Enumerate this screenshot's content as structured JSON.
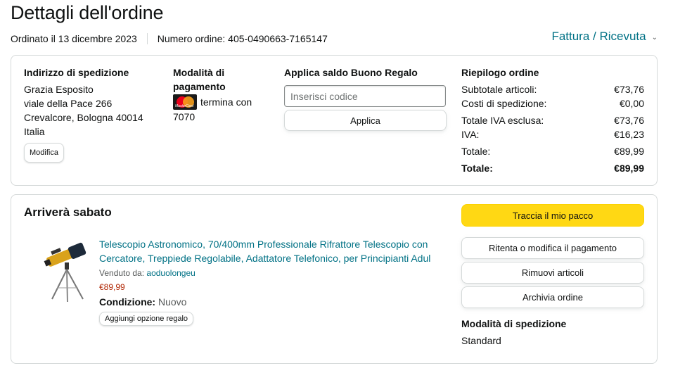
{
  "header": {
    "title": "Dettagli dell'ordine",
    "ordered_on": "Ordinato il 13 dicembre 2023",
    "order_number": "Numero ordine: 405-0490663-7165147",
    "invoice_link": "Fattura / Ricevuta",
    "invoice_chevron": "⌄"
  },
  "shipping_address": {
    "title": "Indirizzo di spedizione",
    "lines": [
      "Grazia Esposito",
      "viale della Pace 266",
      "Crevalcore, Bologna 40014",
      "Italia"
    ],
    "edit_label": "Modifica"
  },
  "payment": {
    "title": "Modalità di pagamento",
    "card_icon": "mastercard-icon",
    "card_brand_text": "MasterCard",
    "card_text": "termina con",
    "card_last4": "7070"
  },
  "gift_balance": {
    "title": "Applica saldo Buono Regalo",
    "input_placeholder": "Inserisci codice",
    "input_value": "",
    "apply_label": "Applica"
  },
  "order_summary": {
    "title": "Riepilogo ordine",
    "rows": [
      {
        "label": "Subtotale articoli:",
        "value": "€73,76"
      },
      {
        "label": "Costi di spedizione:",
        "value": "€0,00"
      },
      {
        "label": "Totale IVA esclusa:",
        "value": "€73,76"
      },
      {
        "label": "IVA:",
        "value": "€16,23"
      },
      {
        "label": "Totale:",
        "value": "€89,99"
      },
      {
        "label": "Totale:",
        "value": "€89,99"
      }
    ]
  },
  "shipment": {
    "arrival_text": "Arriverà sabato",
    "product": {
      "image_icon": "telescope-image",
      "title_line1": "Telescopio Astronomico, 70/400mm Professionale Rifrattore Telescopio con",
      "title_line2": "Cercatore, Treppiede Regolabile, Adattatore Telefonico, per Principianti Adul",
      "sold_by_label": "Venduto da:",
      "seller": "aoduolongeu",
      "price": "€89,99",
      "condition_label": "Condizione:",
      "condition_value": "Nuovo",
      "gift_option_label": "Aggiungi opzione regalo"
    },
    "actions": {
      "track": "Traccia il mio pacco",
      "retry_payment": "Ritenta o modifica il pagamento",
      "remove_items": "Rimuovi articoli",
      "archive_order": "Archivia ordine"
    },
    "shipping_mode": {
      "title": "Modalità di spedizione",
      "value": "Standard"
    }
  },
  "colors": {
    "link": "#007185",
    "price": "#b12704",
    "track_button": "#ffd814",
    "border": "#d5d9d9"
  }
}
